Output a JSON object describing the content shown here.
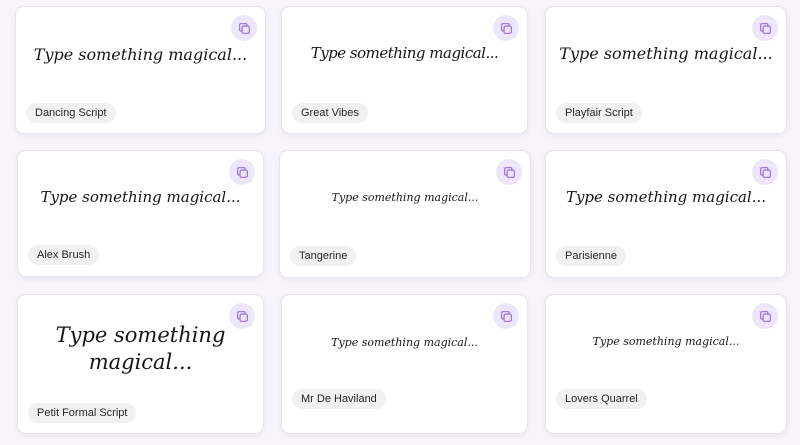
{
  "accent_color": "#ece6fb",
  "icon_color": "#a27ad9",
  "copy_icon": "copy-icon",
  "cards": [
    {
      "font_name": "Dancing Script",
      "sample": "Type something magical..."
    },
    {
      "font_name": "Great Vibes",
      "sample": "Type something magical..."
    },
    {
      "font_name": "Playfair Script",
      "sample": "Type something magical..."
    },
    {
      "font_name": "Alex Brush",
      "sample": "Type something magical..."
    },
    {
      "font_name": "Tangerine",
      "sample": "Type something magical..."
    },
    {
      "font_name": "Parisienne",
      "sample": "Type something magical..."
    },
    {
      "font_name": "Petit Formal Script",
      "sample_line1": "Type something",
      "sample_line2": "magical..."
    },
    {
      "font_name": "Mr De Haviland",
      "sample": "Type something magical..."
    },
    {
      "font_name": "Lovers Quarrel",
      "sample": "Type something magical..."
    }
  ]
}
